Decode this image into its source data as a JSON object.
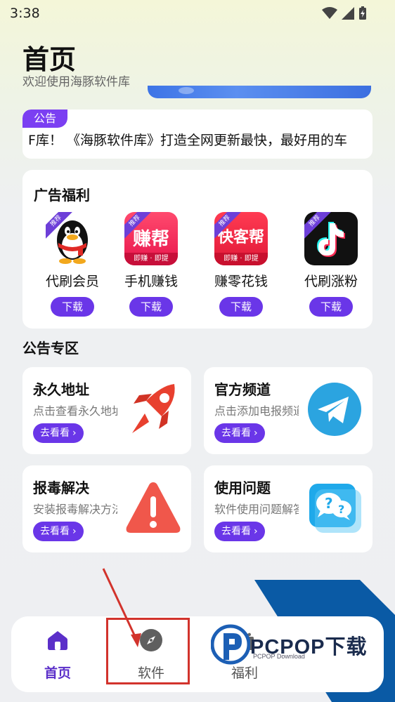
{
  "status_bar": {
    "time": "3:38"
  },
  "header": {
    "title": "首页",
    "subtitle": "欢迎使用海豚软件库"
  },
  "notice": {
    "tag": "公告",
    "text": "F库！  《海豚软件库》打造全网更新最快，最好用的车"
  },
  "ads": {
    "title": "广告福利",
    "badge": "推荐",
    "download_label": "下载",
    "items": [
      {
        "name": "代刷会员",
        "icon": "qq-penguin-icon"
      },
      {
        "name": "手机赚钱",
        "icon": "zhuan-bang-icon",
        "icon_text": "赚帮",
        "icon_sub": "即赚 · 即提"
      },
      {
        "name": "赚零花钱",
        "icon": "kuaikebang-icon",
        "icon_text": "快客帮",
        "icon_sub": "即赚 · 即提"
      },
      {
        "name": "代刷涨粉",
        "icon": "tiktok-icon"
      }
    ]
  },
  "announcements": {
    "title": "公告专区",
    "go_label": "去看看",
    "tiles": [
      {
        "title": "永久地址",
        "desc": "点击查看永久地址",
        "icon": "rocket-icon"
      },
      {
        "title": "官方频道",
        "desc": "点击添加电报频道",
        "icon": "telegram-icon"
      },
      {
        "title": "报毒解决",
        "desc": "安装报毒解决方法",
        "icon": "warning-icon"
      },
      {
        "title": "使用问题",
        "desc": "软件使用问题解答",
        "icon": "question-chat-icon"
      }
    ]
  },
  "tabs": [
    {
      "label": "首页",
      "icon": "home-icon",
      "active": true
    },
    {
      "label": "软件",
      "icon": "compass-icon",
      "active": false
    },
    {
      "label": "福利",
      "icon": "gift-icon",
      "active": false
    }
  ],
  "watermark": {
    "text": "PCPOP下载",
    "sub": "PCPOP Download"
  },
  "colors": {
    "accent": "#6a36e8",
    "tag": "#7b3ff2",
    "highlight": "#d2332c"
  }
}
